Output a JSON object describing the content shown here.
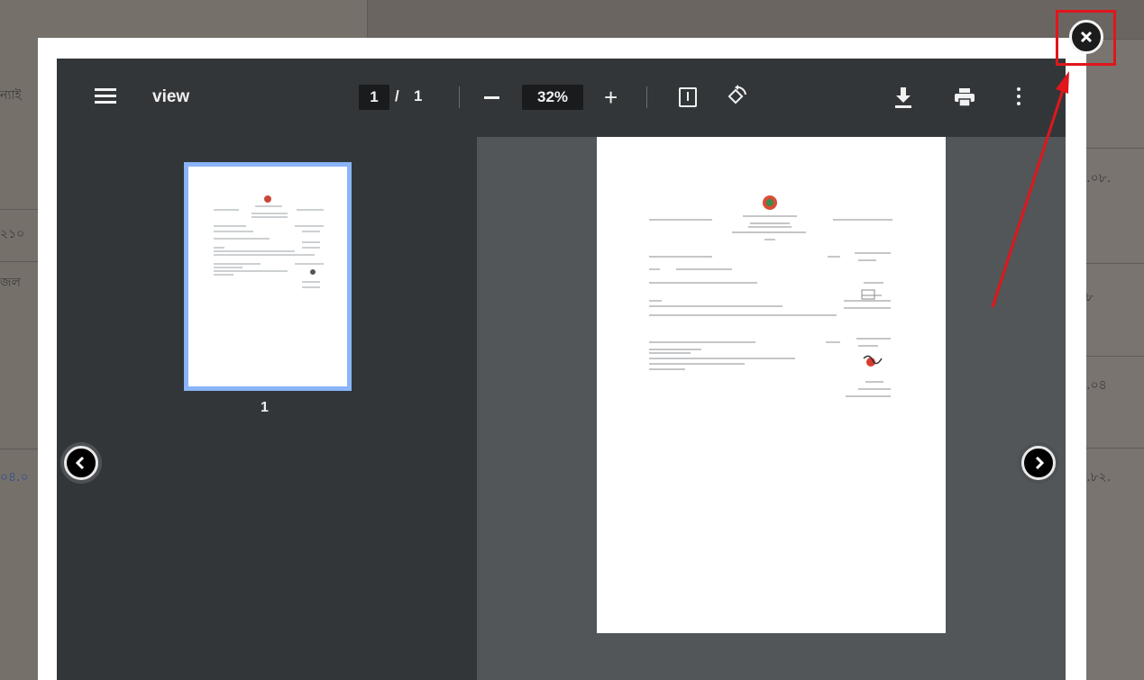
{
  "background": {
    "left_texts": [
      "ন্যাই",
      "২১০",
      "জল",
      "০৪.০"
    ],
    "right_texts": [
      "০.০৮.",
      "৮",
      "৮.০৪",
      "০.৮২."
    ]
  },
  "viewer": {
    "menu_icon": "hamburger-menu-icon",
    "title": "view",
    "page_current": "1",
    "page_separator": "/",
    "page_total": "1",
    "zoom_level": "32%",
    "zoom_out_icon": "minus-icon",
    "zoom_in_icon": "plus-icon",
    "fit_icon": "fit-to-page-icon",
    "rotate_icon": "rotate-icon",
    "download_icon": "download-icon",
    "print_icon": "print-icon",
    "more_icon": "more-vertical-icon",
    "thumbnail_label": "1",
    "prev_icon": "chevron-left-icon",
    "next_icon": "chevron-right-icon"
  },
  "close_icon": "close-icon",
  "annotation": {
    "highlight_color": "#e0161b",
    "arrow_color": "#e0161b"
  },
  "colors": {
    "toolbar": "#323639",
    "viewer_bg": "#525659",
    "thumbnail_border": "#8ab4f8"
  }
}
